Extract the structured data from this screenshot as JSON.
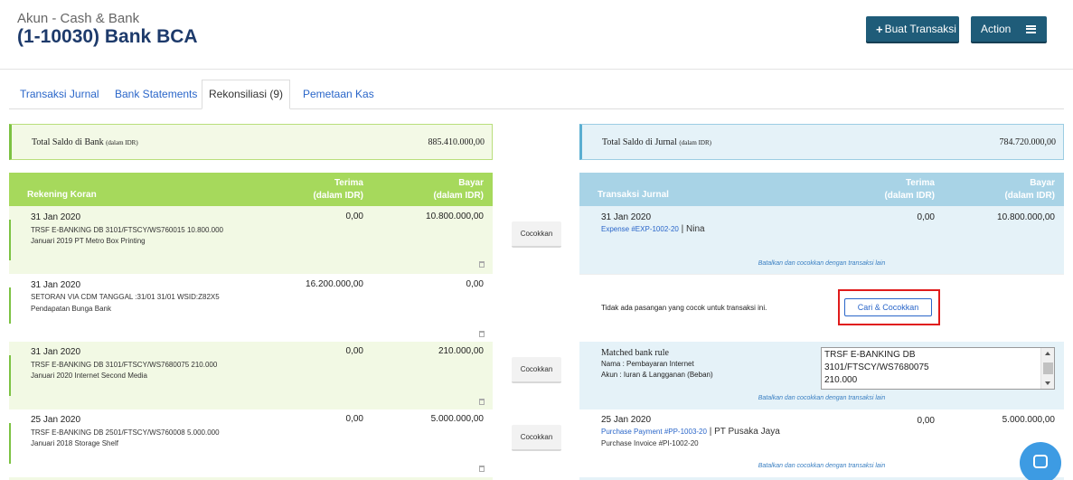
{
  "header": {
    "subtitle": "Akun - Cash & Bank",
    "title": "(1-10030) Bank BCA",
    "buat_label": "Buat Transaksi",
    "action_label": "Action"
  },
  "tabs": [
    {
      "label": "Transaksi Jurnal"
    },
    {
      "label": "Bank Statements"
    },
    {
      "label": "Rekonsiliasi (9)"
    },
    {
      "label": "Pemetaan Kas"
    }
  ],
  "bank": {
    "total_label": "Total Saldo di Bank",
    "total_unit": "(dalam IDR)",
    "total_value": "885.410.000,00",
    "col_name": "Rekening Koran",
    "col_terima": "Terima",
    "col_bayar": "Bayar",
    "col_unit": "(dalam IDR)",
    "rows": [
      {
        "date": "31 Jan 2020",
        "desc1": "TRSF E-BANKING DB 3101/FTSCY/WS760015 10.800.000",
        "desc2": "Januari 2019 PT Metro Box Printing",
        "terima": "0,00",
        "bayar": "10.800.000,00"
      },
      {
        "date": "31 Jan 2020",
        "desc1": "SETORAN VIA CDM TANGGAL :31/01 31/01 WSID:Z82X5",
        "desc2": "Pendapatan Bunga Bank",
        "terima": "16.200.000,00",
        "bayar": "0,00"
      },
      {
        "date": "31 Jan 2020",
        "desc1": "TRSF E-BANKING DB 3101/FTSCY/WS7680075 210.000",
        "desc2": "Januari 2020 Internet Second Media",
        "terima": "0,00",
        "bayar": "210.000,00"
      },
      {
        "date": "25 Jan 2020",
        "desc1": "TRSF E-BANKING DB 2501/FTSCY/WS760008 5.000.000",
        "desc2": "Januari 2018 Storage Shelf",
        "terima": "0,00",
        "bayar": "5.000.000,00"
      }
    ]
  },
  "cocokkan_label": "Cocokkan",
  "jurnal": {
    "total_label": "Total Saldo di Jurnal",
    "total_unit": "(dalam IDR)",
    "total_value": "784.720.000,00",
    "col_name": "Transaksi Jurnal",
    "col_terima": "Terima",
    "col_bayar": "Bayar",
    "col_unit": "(dalam IDR)",
    "row1": {
      "date": "31 Jan 2020",
      "link": "Expense #EXP-1002-20",
      "sep": " | ",
      "party": "Nina",
      "terima": "0,00",
      "bayar": "10.800.000,00"
    },
    "batalkan": "Batalkan dan cocokkan dengan transaksi lain",
    "nomatch": "Tidak ada pasangan yang cocok untuk transaksi ini.",
    "cari_label": "Cari & Cocokkan",
    "rule": {
      "title": "Matched bank rule",
      "nama": "Nama : Pembayaran Internet",
      "akun": "Akun : Iuran & Langganan (Beban)",
      "line1": "TRSF E-BANKING DB",
      "line2": "3101/FTSCY/WS7680075",
      "line3": "210.000"
    },
    "row4": {
      "date": "25 Jan 2020",
      "link": "Purchase Payment #PP-1003-20",
      "sep": " | ",
      "party": "PT Pusaka Jaya",
      "desc2": "Purchase Invoice #PI-1002-20",
      "terima": "0,00",
      "bayar": "5.000.000,00"
    }
  }
}
